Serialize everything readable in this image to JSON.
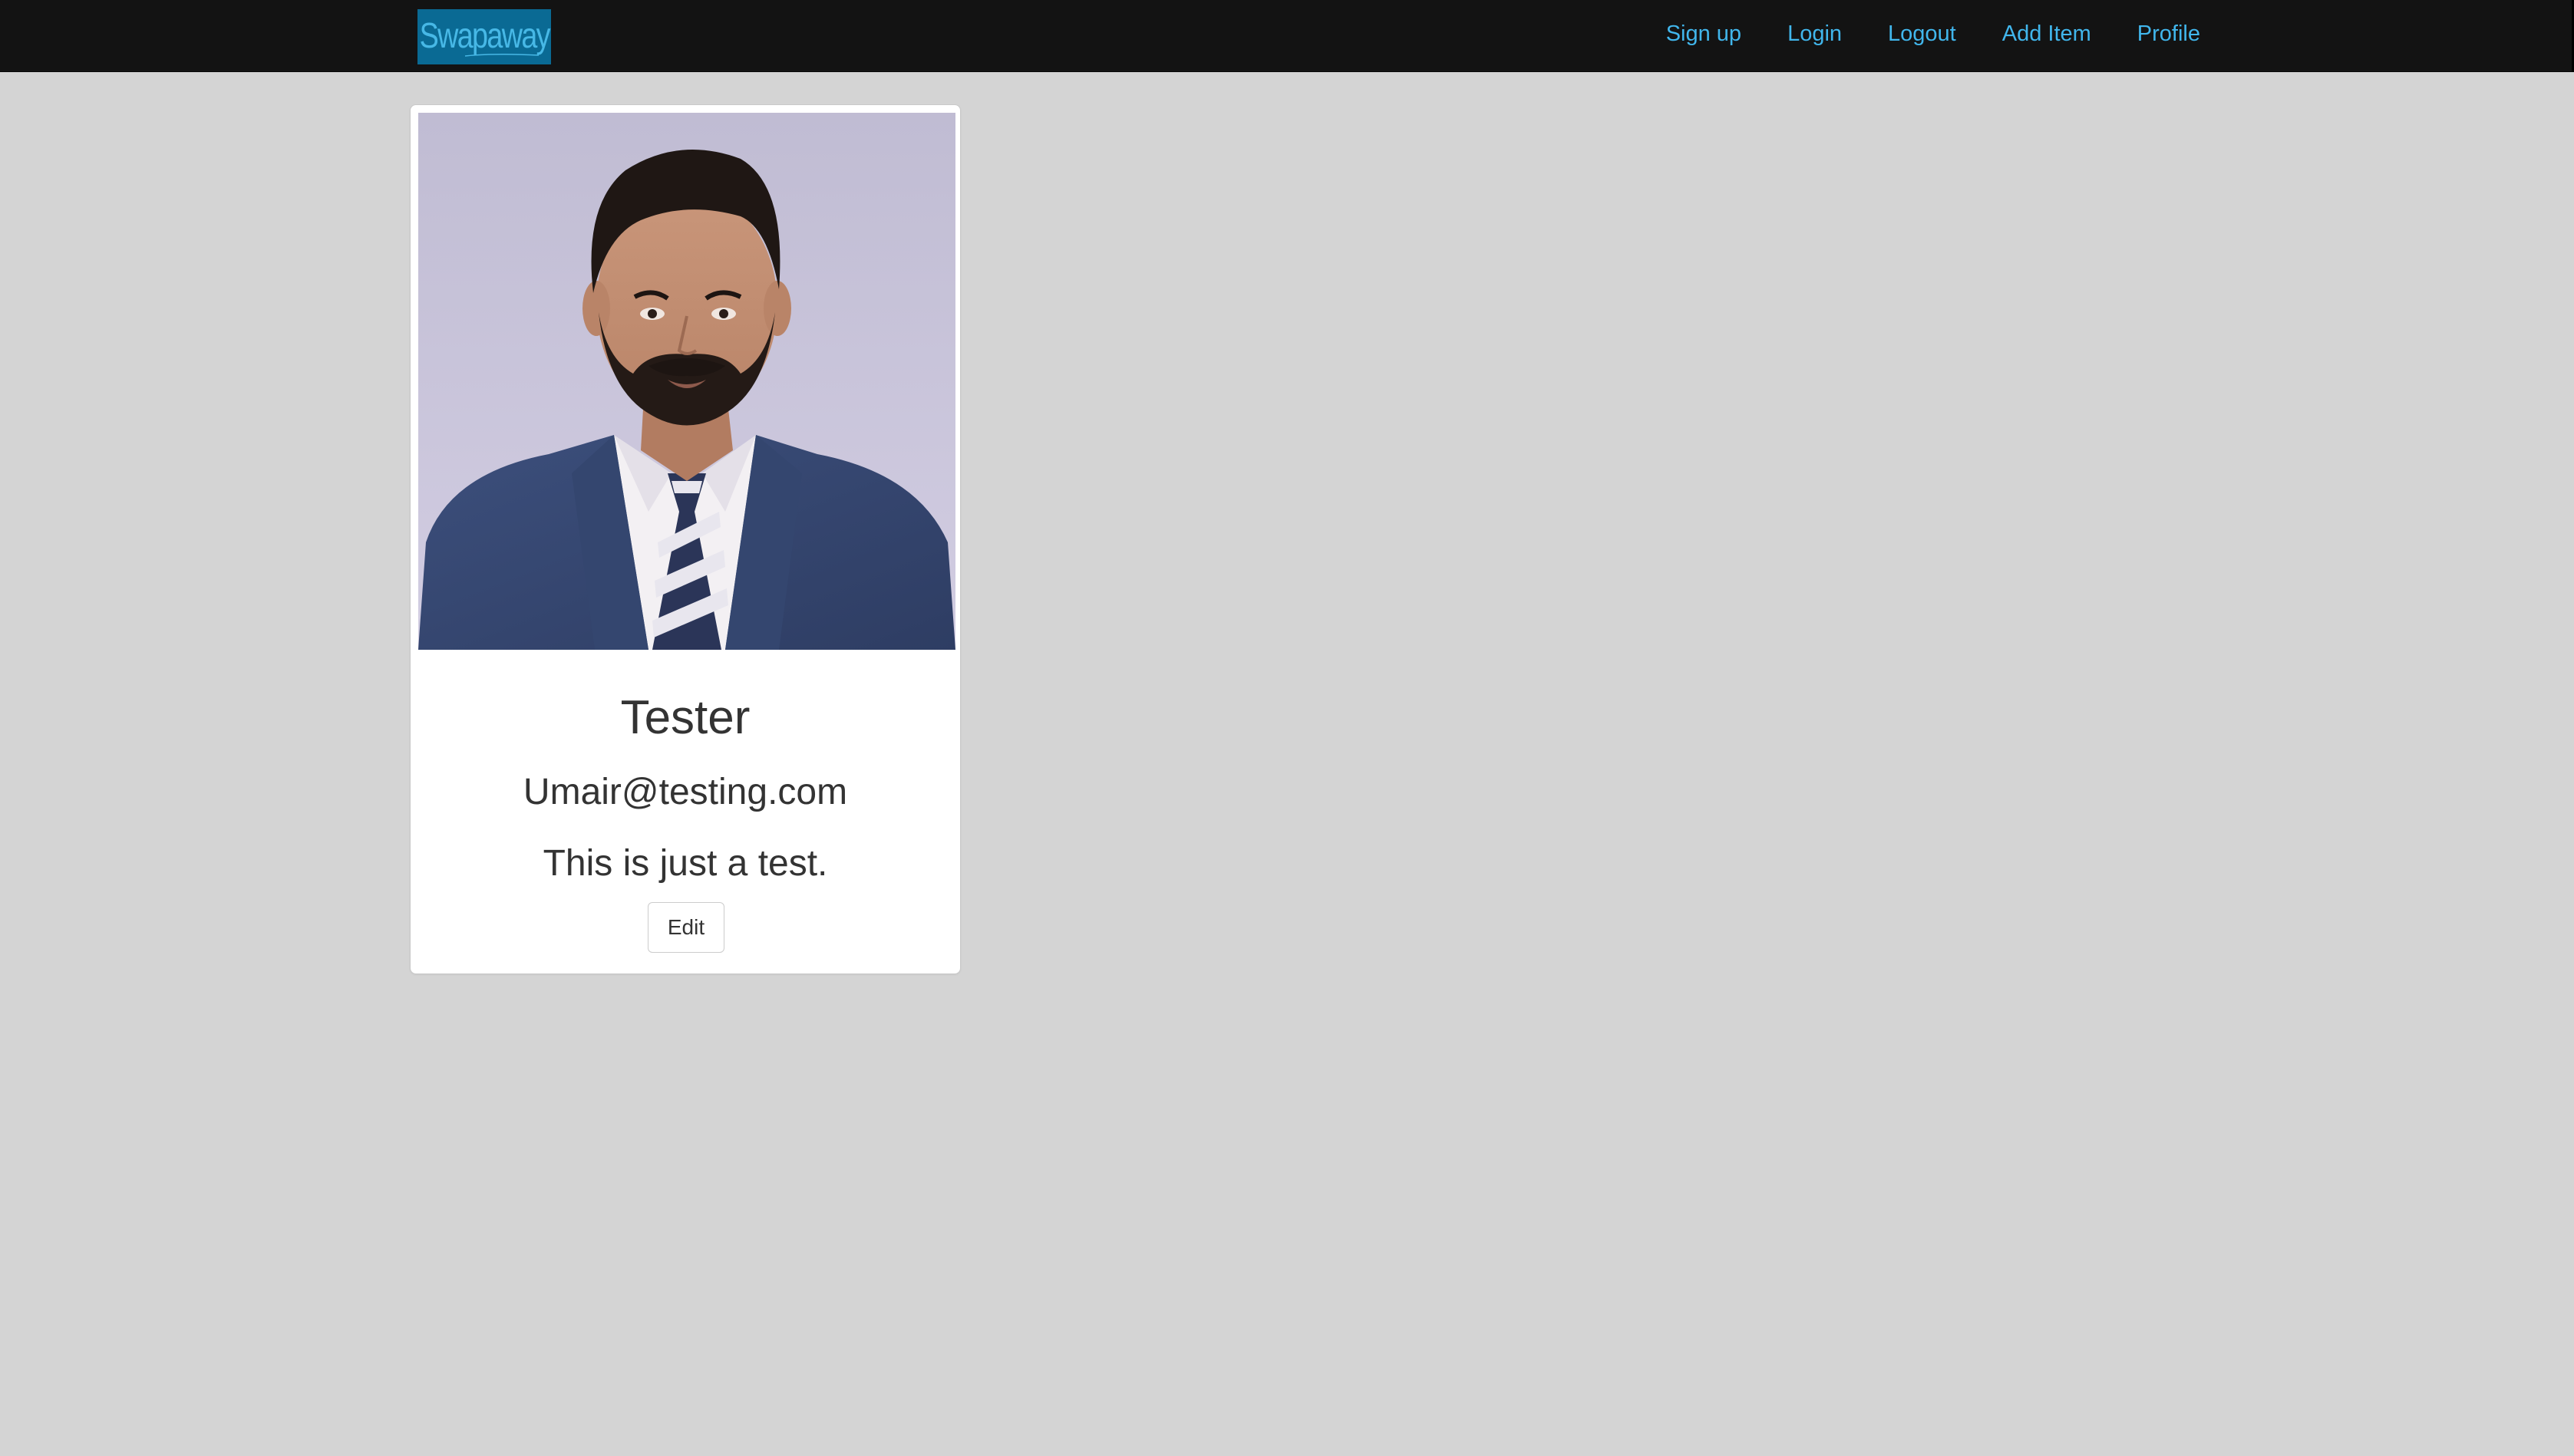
{
  "navbar": {
    "brand": "Swapaway",
    "links": [
      "Sign up",
      "Login",
      "Logout",
      "Add Item",
      "Profile"
    ]
  },
  "profile": {
    "name": "Tester",
    "email": "Umair@testing.com",
    "bio": "This is just a test.",
    "edit_label": "Edit"
  },
  "colors": {
    "page_background": "#d4d4d4",
    "navbar_background": "#131313",
    "brand_background": "#0a6a94",
    "brand_text": "#47b8e6",
    "nav_link": "#41b6ec",
    "text": "#333333",
    "card_background": "#ffffff"
  },
  "icons": {
    "photo": "profile-photo"
  }
}
